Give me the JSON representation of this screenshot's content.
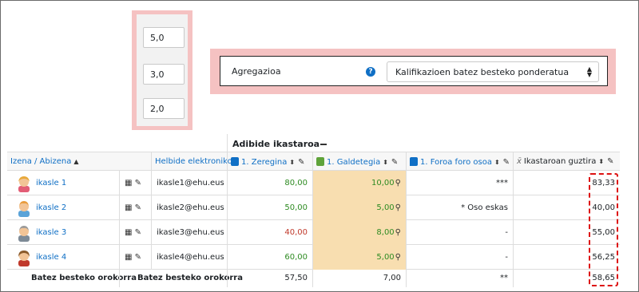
{
  "weights": [
    "5,0",
    "3,0",
    "2,0"
  ],
  "aggregation": {
    "label": "Agregazioa",
    "help_icon": "question-circle-icon",
    "selected": "Kalifikazioen batez besteko ponderatua"
  },
  "course": {
    "title": "Adibide ikastaroa"
  },
  "columns": {
    "name": "Izena / Abizena",
    "email": "Helbide elektronikoa",
    "assignment": "1. Zeregina",
    "quiz": "1. Galdetegia",
    "forum": "1. Foroa foro osoa",
    "total": "Ikastaroan guztira"
  },
  "colors": {
    "assignment_icon": "#0f6fc5",
    "quiz_icon": "#5fa33a",
    "forum_icon": "#0f6fc5",
    "highlight": "#d11111",
    "quiz_bg": "#f8deb0"
  },
  "students": [
    {
      "name": "ikasle 1",
      "email": "ikasle1@ehu.eus",
      "assignment": "80,00",
      "assignment_status": "pass",
      "quiz": "10,00",
      "quiz_status": "pass",
      "forum": "***",
      "total": "83,33"
    },
    {
      "name": "ikasle 2",
      "email": "ikasle2@ehu.eus",
      "assignment": "50,00",
      "assignment_status": "pass",
      "quiz": "5,00",
      "quiz_status": "pass",
      "forum": "* Oso eskas",
      "total": "40,00"
    },
    {
      "name": "ikasle 3",
      "email": "ikasle3@ehu.eus",
      "assignment": "40,00",
      "assignment_status": "fail",
      "quiz": "8,00",
      "quiz_status": "pass",
      "forum": "-",
      "total": "55,00"
    },
    {
      "name": "ikasle 4",
      "email": "ikasle4@ehu.eus",
      "assignment": "60,00",
      "assignment_status": "pass",
      "quiz": "5,00",
      "quiz_status": "pass",
      "forum": "-",
      "total": "56,25"
    }
  ],
  "footer": {
    "label1": "Batez besteko orokorra",
    "label2": "Batez besteko orokorra",
    "assignment": "57,50",
    "quiz": "7,00",
    "forum": "**",
    "total": "58,65"
  }
}
